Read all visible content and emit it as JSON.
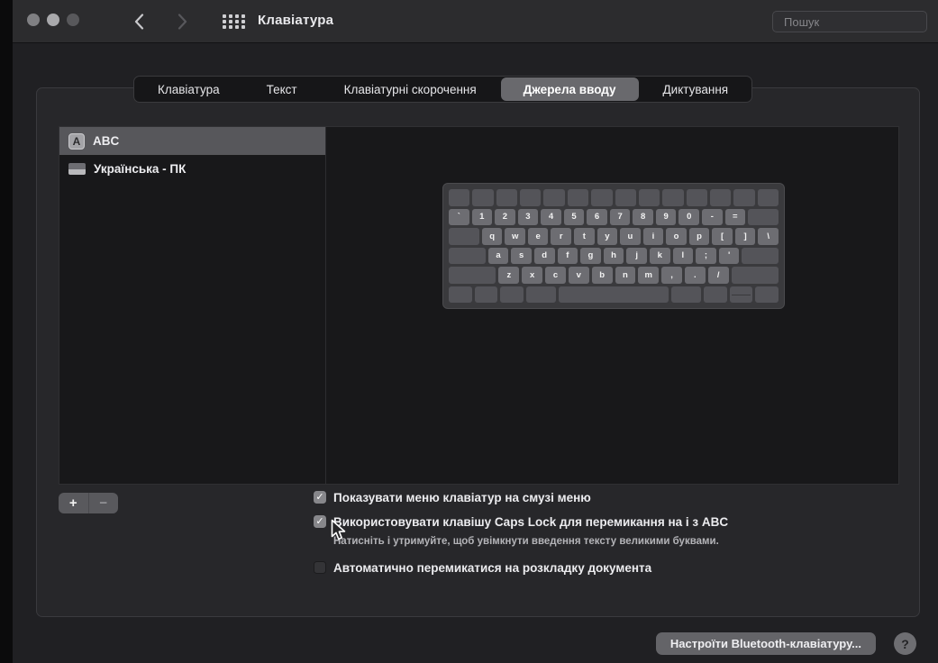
{
  "titlebar": {
    "title": "Клавіатура"
  },
  "search": {
    "placeholder": "Пошук"
  },
  "icons": {
    "checkmark": "✓",
    "back_chevron": "chevron-left",
    "forward_chevron": "chevron-right",
    "show_all_grid": "grid-of-dots",
    "search": "magnifier"
  },
  "tabs": [
    {
      "label": "Клавіатура",
      "selected": false
    },
    {
      "label": "Текст",
      "selected": false
    },
    {
      "label": "Клавіатурні скорочення",
      "selected": false
    },
    {
      "label": "Джерела вводу",
      "selected": true
    },
    {
      "label": "Диктування",
      "selected": false
    }
  ],
  "input_sources": {
    "items": [
      {
        "label": "ABC",
        "icon": "abc-keyboard-icon",
        "icon_letter": "A",
        "selected": true
      },
      {
        "label": "Українська - ПК",
        "icon": "ukrainian-flag-icon",
        "selected": false
      }
    ]
  },
  "list_controls": {
    "add_label": "+",
    "remove_label": "−"
  },
  "keyboard_preview": {
    "rows": [
      [
        {
          "u": 1
        },
        {
          "u": 1
        },
        {
          "u": 1
        },
        {
          "u": 1
        },
        {
          "u": 1
        },
        {
          "u": 1
        },
        {
          "u": 1
        },
        {
          "u": 1
        },
        {
          "u": 1
        },
        {
          "u": 1
        },
        {
          "u": 1
        },
        {
          "u": 1
        },
        {
          "u": 1
        },
        {
          "u": 1
        }
      ],
      [
        {
          "label": "`",
          "u": 1
        },
        {
          "label": "1",
          "u": 1
        },
        {
          "label": "2",
          "u": 1
        },
        {
          "label": "3",
          "u": 1
        },
        {
          "label": "4",
          "u": 1
        },
        {
          "label": "5",
          "u": 1
        },
        {
          "label": "6",
          "u": 1
        },
        {
          "label": "7",
          "u": 1
        },
        {
          "label": "8",
          "u": 1
        },
        {
          "label": "9",
          "u": 1
        },
        {
          "label": "0",
          "u": 1
        },
        {
          "label": "-",
          "u": 1
        },
        {
          "label": "=",
          "u": 1
        },
        {
          "u": 1.5
        }
      ],
      [
        {
          "u": 1.5
        },
        {
          "label": "q",
          "u": 1
        },
        {
          "label": "w",
          "u": 1
        },
        {
          "label": "e",
          "u": 1
        },
        {
          "label": "r",
          "u": 1
        },
        {
          "label": "t",
          "u": 1
        },
        {
          "label": "y",
          "u": 1
        },
        {
          "label": "u",
          "u": 1
        },
        {
          "label": "i",
          "u": 1
        },
        {
          "label": "o",
          "u": 1
        },
        {
          "label": "p",
          "u": 1
        },
        {
          "label": "[",
          "u": 1
        },
        {
          "label": "]",
          "u": 1
        },
        {
          "label": "\\",
          "u": 1
        }
      ],
      [
        {
          "u": 1.8
        },
        {
          "label": "a",
          "u": 1
        },
        {
          "label": "s",
          "u": 1
        },
        {
          "label": "d",
          "u": 1
        },
        {
          "label": "f",
          "u": 1
        },
        {
          "label": "g",
          "u": 1
        },
        {
          "label": "h",
          "u": 1
        },
        {
          "label": "j",
          "u": 1
        },
        {
          "label": "k",
          "u": 1
        },
        {
          "label": "l",
          "u": 1
        },
        {
          "label": ";",
          "u": 1
        },
        {
          "label": "'",
          "u": 1
        },
        {
          "u": 1.8
        }
      ],
      [
        {
          "u": 2.3
        },
        {
          "label": "z",
          "u": 1
        },
        {
          "label": "x",
          "u": 1
        },
        {
          "label": "c",
          "u": 1
        },
        {
          "label": "v",
          "u": 1
        },
        {
          "label": "b",
          "u": 1
        },
        {
          "label": "n",
          "u": 1
        },
        {
          "label": "m",
          "u": 1
        },
        {
          "label": ",",
          "u": 1
        },
        {
          "label": ".",
          "u": 1
        },
        {
          "label": "/",
          "u": 1
        },
        {
          "u": 2.3
        }
      ],
      [
        {
          "u": 1
        },
        {
          "u": 1
        },
        {
          "u": 1
        },
        {
          "u": 1.3
        },
        {
          "u": 4.8
        },
        {
          "u": 1.3
        },
        {
          "u": 1
        },
        {
          "u": 1,
          "split": true
        },
        {
          "u": 1
        }
      ]
    ]
  },
  "checkboxes": [
    {
      "checked": true,
      "label": "Показувати меню клавіатур на смузі меню"
    },
    {
      "checked": true,
      "label": "Використовувати клавішу Caps Lock для перемикання на і з ABC",
      "note": "Натисніть і утримуйте, щоб увімкнути введення тексту великими буквами."
    },
    {
      "checked": false,
      "label": "Автоматично перемикатися на розкладку документа"
    }
  ],
  "footer": {
    "bluetooth_button_label": "Настроїти Bluetooth-клавіатуру...",
    "help_label": "?"
  }
}
